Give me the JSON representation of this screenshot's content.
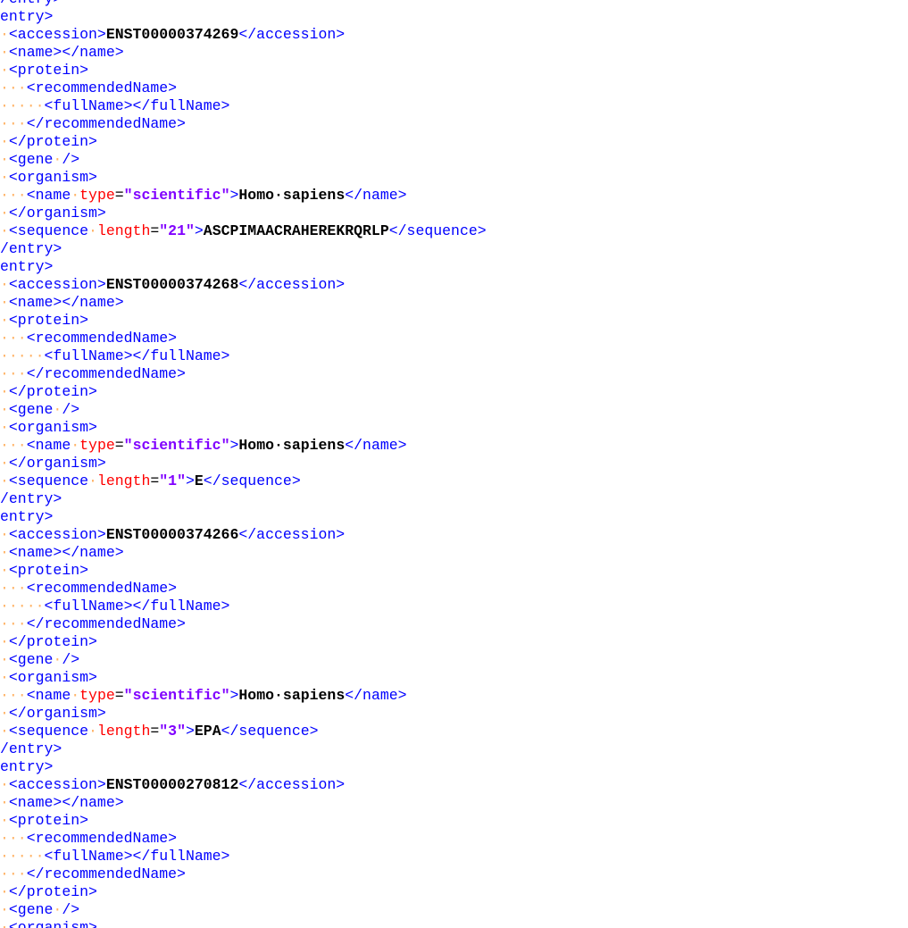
{
  "editor": {
    "first_partial_line": "/entry>",
    "entries": [
      {
        "accession": "ENST00000374269",
        "organism_name_type": "scientific",
        "organism_name": "Homo sapiens",
        "sequence_length": "21",
        "sequence": "ASCPIMAACRAHEREKRQRLP"
      },
      {
        "accession": "ENST00000374268",
        "organism_name_type": "scientific",
        "organism_name": "Homo sapiens",
        "sequence_length": "1",
        "sequence": "E"
      },
      {
        "accession": "ENST00000374266",
        "organism_name_type": "scientific",
        "organism_name": "Homo sapiens",
        "sequence_length": "3",
        "sequence": "EPA"
      },
      {
        "accession": "ENST00000270812",
        "organism_name_type": "scientific",
        "organism_name": "Homo sapiens",
        "sequence_length": "",
        "sequence": ""
      }
    ]
  },
  "colors": {
    "tag": "#0000ff",
    "attribute": "#ff0000",
    "attribute_value": "#8000ff",
    "text": "#000000",
    "whitespace_marker": "#ffb366",
    "background": "#ffffff"
  }
}
